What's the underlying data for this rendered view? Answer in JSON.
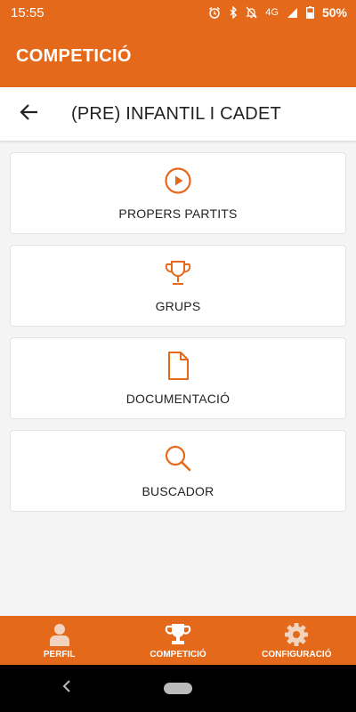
{
  "status_bar": {
    "time": "15:55",
    "network": "4G",
    "battery": "50%"
  },
  "app_bar": {
    "title": "COMPETICIÓ"
  },
  "sub_header": {
    "title": "(PRE) INFANTIL I CADET",
    "back_icon": "arrow-left-icon"
  },
  "menu": {
    "items": [
      {
        "label": "PROPERS PARTITS",
        "icon": "play-circle-icon"
      },
      {
        "label": "GRUPS",
        "icon": "trophy-icon"
      },
      {
        "label": "DOCUMENTACIÓ",
        "icon": "document-icon"
      },
      {
        "label": "BUSCADOR",
        "icon": "search-icon"
      }
    ]
  },
  "bottom_nav": {
    "items": [
      {
        "label": "PERFIL",
        "icon": "person-icon"
      },
      {
        "label": "COMPETICIÓ",
        "icon": "trophy-icon"
      },
      {
        "label": "CONFIGURACIÓ",
        "icon": "gear-icon"
      }
    ]
  },
  "colors": {
    "accent": "#e5691a",
    "background": "#f4f4f4",
    "icon_light": "#f2d3bf"
  }
}
